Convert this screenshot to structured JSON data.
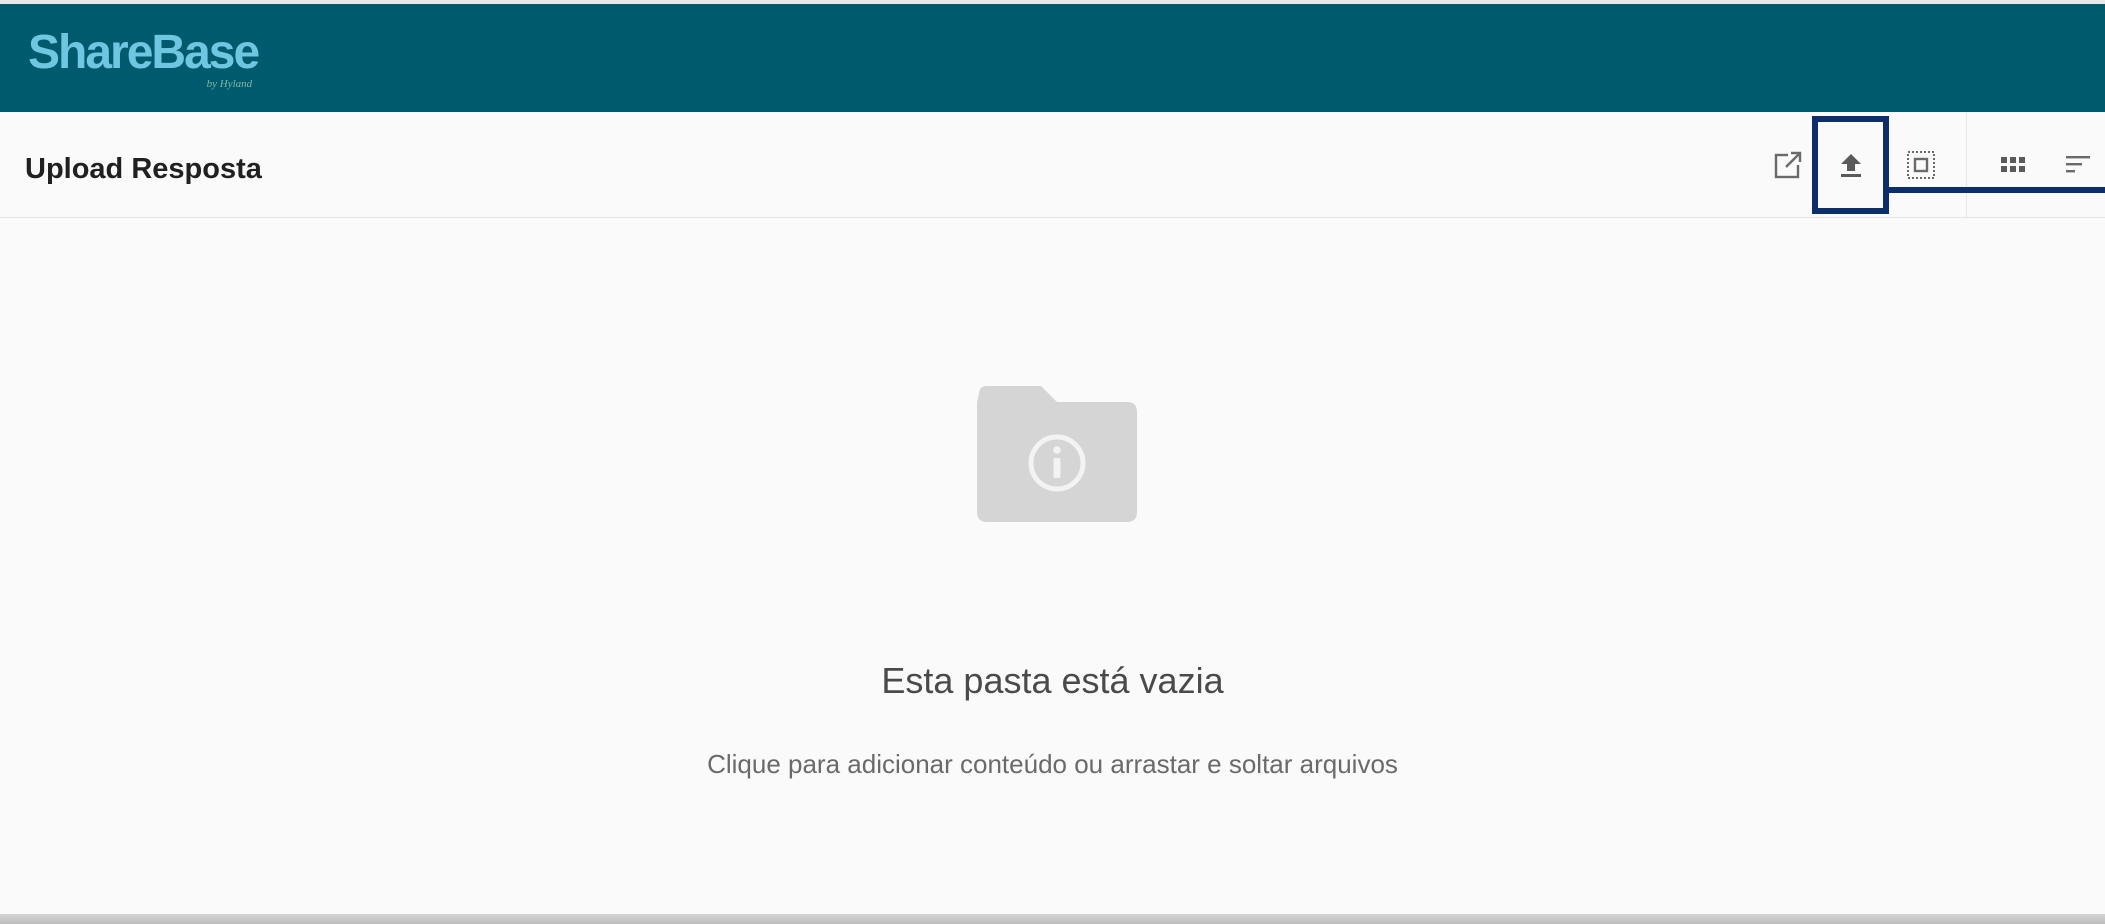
{
  "app": {
    "logo_text": "ShareBase",
    "logo_subtext": "by Hyland"
  },
  "toolbar": {
    "folder_title": "Upload Resposta",
    "actions": [
      {
        "name": "open-external-icon",
        "label": ""
      },
      {
        "name": "upload-icon",
        "label": ""
      },
      {
        "name": "select-all-icon",
        "label": ""
      },
      {
        "name": "grid-view-icon",
        "label": ""
      },
      {
        "name": "sort-icon",
        "label": ""
      }
    ],
    "highlighted_action": "upload"
  },
  "empty_state": {
    "icon": "folder-info-icon",
    "title": "Esta pasta está vazia",
    "subtitle": "Clique para adicionar conteúdo ou arrastar e soltar arquivos"
  },
  "colors": {
    "header_bg": "#005a6e",
    "logo": "#6fc6e0",
    "highlight": "#0c2f6a",
    "icon": "#6a6a6a"
  }
}
